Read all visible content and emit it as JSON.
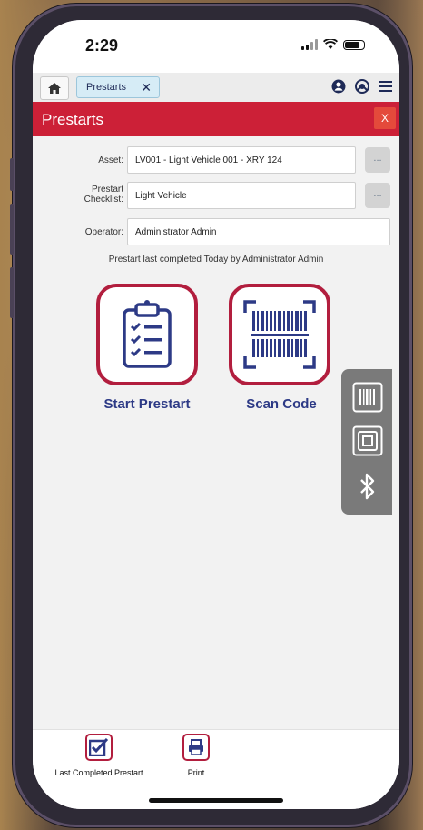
{
  "status": {
    "time": "2:29"
  },
  "tabs": {
    "active_label": "Prestarts",
    "close_glyph": "✕"
  },
  "header": {
    "title": "Prestarts",
    "close_label": "X"
  },
  "form": {
    "asset_label": "Asset:",
    "asset_value": "LV001 - Light Vehicle 001 - XRY 124",
    "checklist_label_line1": "Prestart",
    "checklist_label_line2": "Checklist:",
    "checklist_value": "Light Vehicle",
    "operator_label": "Operator:",
    "operator_value": "Administrator Admin",
    "lookup_label": "...",
    "last_completed_note": "Prestart last completed Today by Administrator Admin"
  },
  "actions": {
    "start_label": "Start Prestart",
    "scan_label": "Scan Code"
  },
  "bottom": {
    "last_completed_label": "Last Completed Prestart",
    "print_label": "Print"
  },
  "colors": {
    "brand_red": "#cc2037",
    "tile_border": "#b21e3e",
    "label_blue": "#2d3a86",
    "icon_blue": "#2d3a86"
  },
  "icons": {
    "home": "home-icon",
    "user": "user-icon",
    "support": "support-icon",
    "menu": "hamburger-menu-icon",
    "checklist": "clipboard-checklist-icon",
    "barcode": "barcode-scan-icon",
    "side_barcode": "barcode-icon",
    "side_nfc": "nfc-tag-icon",
    "side_bluetooth": "bluetooth-icon",
    "checkbox": "checkbox-icon",
    "print": "printer-icon"
  }
}
